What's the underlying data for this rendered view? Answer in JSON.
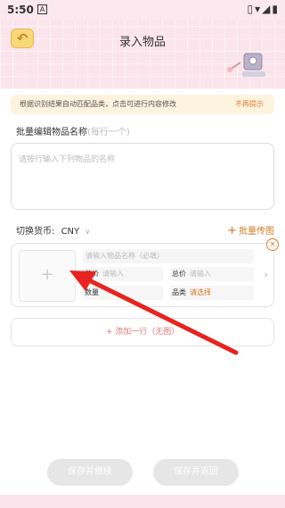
{
  "status_bar": {
    "time": "5:50",
    "notification_badge": "A",
    "system_icons": "▯▾◢▮"
  },
  "header": {
    "title": "录入物品",
    "back_icon": "back-arrow-icon"
  },
  "notice": {
    "text": "根据识别结果自动匹配品类，点击可进行内容修改",
    "dismiss": "不再提示"
  },
  "batch_name": {
    "label": "批量编辑物品名称",
    "hint": "(每行一个)",
    "placeholder": "请按行输入下列物品的名称"
  },
  "currency": {
    "label": "切换货币:",
    "value": "CNY"
  },
  "batch_upload": {
    "plus": "+",
    "label": "批量传图"
  },
  "item": {
    "image_plus": "+",
    "name_placeholder": "请输入物品名称（必填）",
    "price_label": "单价",
    "price_placeholder": "请输入",
    "total_label": "总价",
    "total_placeholder": "请输入",
    "qty_label": "数量",
    "qty_value": "",
    "category_label": "品类",
    "category_placeholder": "请选择",
    "close": "×",
    "row_chevron": "›"
  },
  "add_row": {
    "label": "+ 添加一行（无图）"
  },
  "buttons": {
    "save_continue": "保存并继续",
    "save_return": "保存并返回"
  },
  "colors": {
    "accent_orange": "#d27b23",
    "header_pink": "#fbe4ec",
    "arrow_red": "#e8231f"
  }
}
